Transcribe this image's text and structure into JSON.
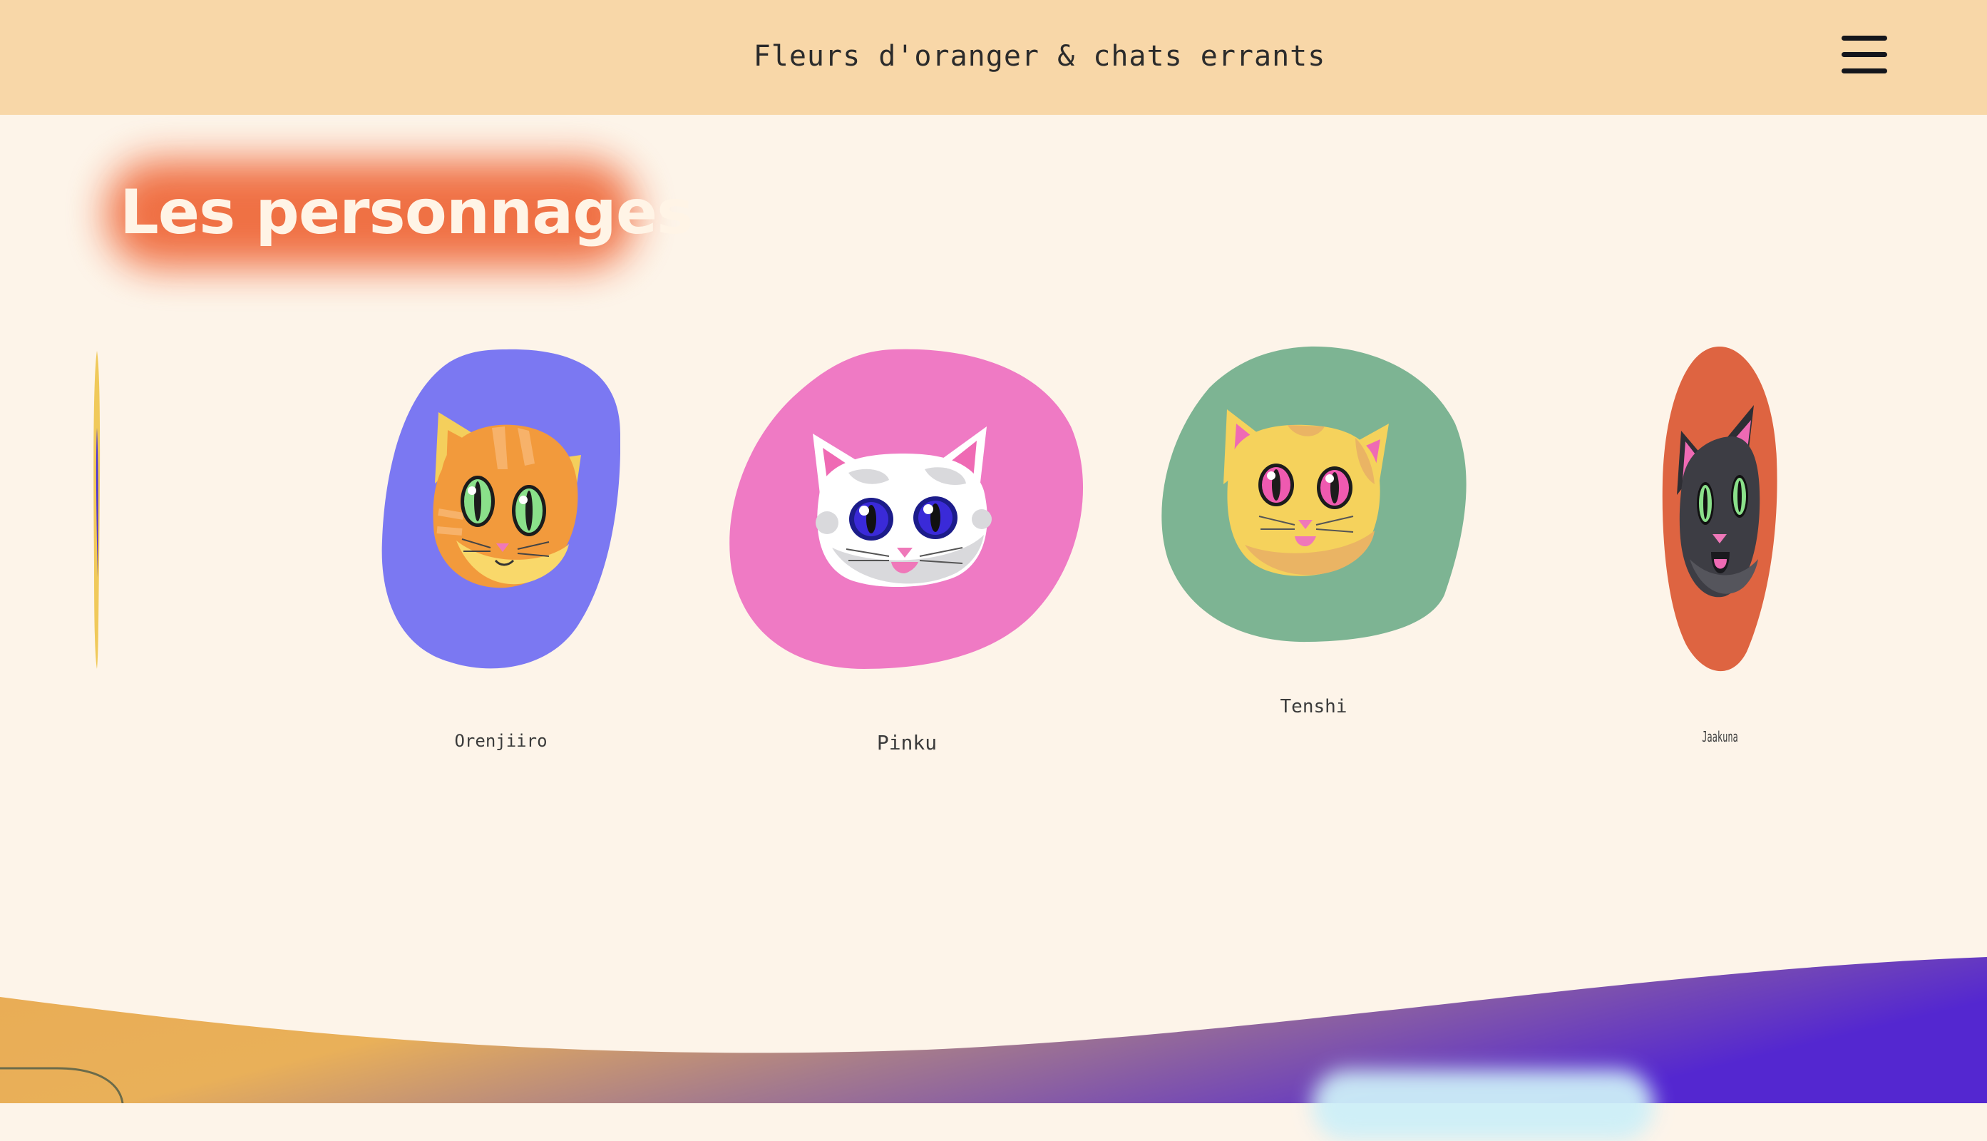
{
  "header": {
    "title": "Fleurs d'oranger & chats errants",
    "menu_icon": "hamburger-menu-icon"
  },
  "section": {
    "heading": "Les personnages"
  },
  "carousel": {
    "characters": [
      {
        "name": "",
        "color": "#f0c95a"
      },
      {
        "name": "Orenjiiro",
        "color": "#7b78f2"
      },
      {
        "name": "Pinku",
        "color": "#ef7ac4"
      },
      {
        "name": "Tenshi",
        "color": "#7db493"
      },
      {
        "name": "Jaakuna",
        "color": "#de6441"
      }
    ]
  },
  "colors": {
    "header_bg": "#f8d7a8",
    "page_bg": "#fdf4e9",
    "accent": "#ef6a3c",
    "wave_start": "#e9b059",
    "wave_end": "#5427d0"
  }
}
